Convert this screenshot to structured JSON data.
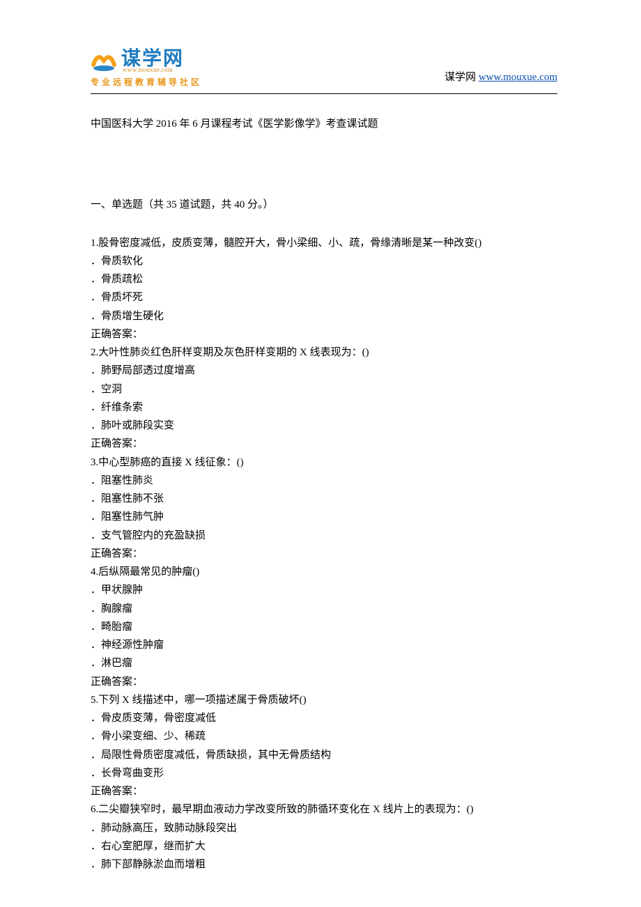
{
  "header": {
    "logo_main": "谋学网",
    "logo_url": "www.mouxue.com",
    "logo_tag": "专业远程教育辅导社区",
    "site_prefix": "谋学网 ",
    "site_link": "www.mouxue.com"
  },
  "title": "中国医科大学 2016 年 6 月课程考试《医学影像学》考查课试题",
  "section": "一、单选题（共 35 道试题，共 40 分。）",
  "answer_label": "正确答案：",
  "questions": [
    {
      "stem": "1.股骨密度减低，皮质变薄，髓腔开大，骨小梁细、小、疏，骨缘清晰是某一种改变()",
      "options": [
        "．骨质软化",
        "．骨质疏松",
        "．骨质坏死",
        "．骨质增生硬化"
      ],
      "show_answer": true
    },
    {
      "stem": "2.大叶性肺炎红色肝样变期及灰色肝样变期的 X 线表现为：()",
      "options": [
        "．肺野局部透过度增高",
        "．空洞",
        "．纤维条索",
        "．肺叶或肺段实变"
      ],
      "show_answer": true
    },
    {
      "stem": "3.中心型肺癌的直接 X 线征象：()",
      "options": [
        "．阻塞性肺炎",
        "．阻塞性肺不张",
        "．阻塞性肺气肿",
        "．支气管腔内的充盈缺损"
      ],
      "show_answer": true
    },
    {
      "stem": "4.后纵隔最常见的肿瘤()",
      "options": [
        "．甲状腺肿",
        "．胸腺瘤",
        "．畸胎瘤",
        "．神经源性肿瘤",
        "．淋巴瘤"
      ],
      "show_answer": true
    },
    {
      "stem": "5.下列 X 线描述中，哪一项描述属于骨质破坏()",
      "options": [
        "．骨皮质变薄，骨密度减低",
        "．骨小梁变细、少、稀疏",
        "．局限性骨质密度减低，骨质缺损，其中无骨质结构",
        "．长骨弯曲变形"
      ],
      "show_answer": true
    },
    {
      "stem": "6.二尖瓣狭窄时，最早期血液动力学改变所致的肺循环变化在 X 线片上的表现为：()",
      "options": [
        "．肺动脉高压，致肺动脉段突出",
        "．右心室肥厚，继而扩大",
        "．肺下部静脉淤血而增粗"
      ],
      "show_answer": false
    }
  ]
}
